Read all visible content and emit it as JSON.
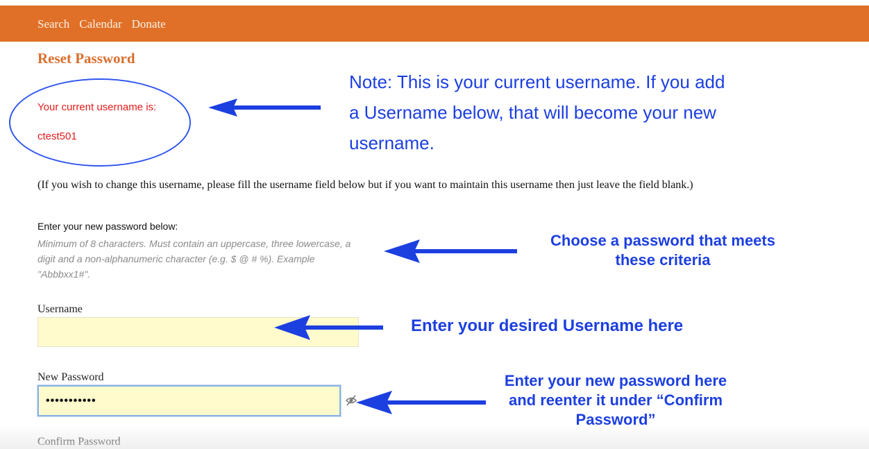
{
  "nav": {
    "items": [
      "Search",
      "Calendar",
      "Donate"
    ]
  },
  "page": {
    "title": "Reset Password"
  },
  "account": {
    "current_username_label": "Your current username is:",
    "current_username_value": "ctest501"
  },
  "annotations": {
    "note": "Note: This is your current username. If you add a Username below, that will become your new username.",
    "password_criteria": "Choose a password that meets these criteria",
    "username": "Enter your desired Username here",
    "new_password": "Enter your new password here and reenter it under “Confirm Password”",
    "color": "#1c3fe0"
  },
  "form": {
    "hint": "(If you wish to change this username, please fill the username field below but if you want to maintain this username then just leave the field blank.)",
    "password_heading": "Enter your new password below:",
    "password_help": "Minimum of 8 characters. Must contain an uppercase, three lowercase, a digit and a non-alphanumeric character (e.g. $ @ # %). Example \"Abbbxx1#\".",
    "username_label": "Username",
    "username_value": "",
    "new_password_label": "New Password",
    "new_password_value": "•••••••••••",
    "confirm_password_label": "Confirm Password"
  },
  "icons": {
    "toggle_visibility": "eye-slash-icon",
    "arrows": "left-arrow-icon"
  },
  "colors": {
    "header": "#e07028",
    "title": "#d96e2c",
    "current_username": "#e41b1b",
    "input_background": "#fffbcd"
  }
}
